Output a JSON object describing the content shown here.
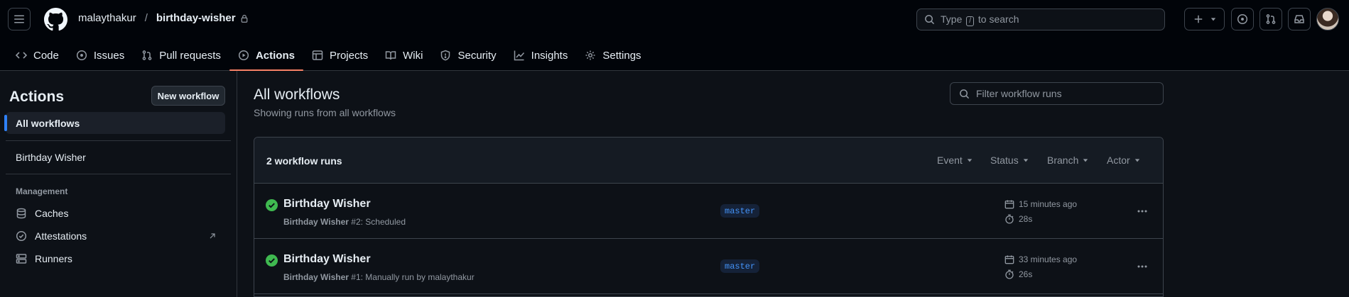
{
  "header": {
    "owner": "malaythakur",
    "separator": "/",
    "repo": "birthday-wisher",
    "search": {
      "prefix": "Type",
      "key": "/",
      "suffix": "to search"
    }
  },
  "nav": {
    "tabs": [
      {
        "label": "Code",
        "icon": "code-icon"
      },
      {
        "label": "Issues",
        "icon": "issue-icon"
      },
      {
        "label": "Pull requests",
        "icon": "pull-request-icon"
      },
      {
        "label": "Actions",
        "icon": "play-icon",
        "active": true
      },
      {
        "label": "Projects",
        "icon": "table-icon"
      },
      {
        "label": "Wiki",
        "icon": "book-icon"
      },
      {
        "label": "Security",
        "icon": "shield-icon"
      },
      {
        "label": "Insights",
        "icon": "graph-icon"
      },
      {
        "label": "Settings",
        "icon": "gear-icon"
      }
    ]
  },
  "sidebar": {
    "title": "Actions",
    "new_workflow": "New workflow",
    "all_workflows": "All workflows",
    "workflows": [
      "Birthday Wisher"
    ],
    "management_label": "Management",
    "management": [
      {
        "label": "Caches",
        "icon": "database-icon"
      },
      {
        "label": "Attestations",
        "icon": "verified-icon"
      },
      {
        "label": "Runners",
        "icon": "server-icon"
      }
    ]
  },
  "main": {
    "title": "All workflows",
    "subtitle": "Showing runs from all workflows",
    "filter_placeholder": "Filter workflow runs",
    "runs_count": "2 workflow runs",
    "filters": [
      "Event",
      "Status",
      "Branch",
      "Actor"
    ],
    "runs": [
      {
        "title": "Birthday Wisher",
        "workflow": "Birthday Wisher",
        "detail": "#2: Scheduled",
        "branch": "master",
        "time": "15 minutes ago",
        "duration": "28s",
        "status": "success"
      },
      {
        "title": "Birthday Wisher",
        "workflow": "Birthday Wisher",
        "detail": "#1: Manually run by malaythakur",
        "branch": "master",
        "time": "33 minutes ago",
        "duration": "26s",
        "status": "success"
      }
    ]
  },
  "colors": {
    "accent_blue": "#2f81f7",
    "success": "#3fb950",
    "active_underline": "#f78166",
    "background": "#0d1117"
  }
}
